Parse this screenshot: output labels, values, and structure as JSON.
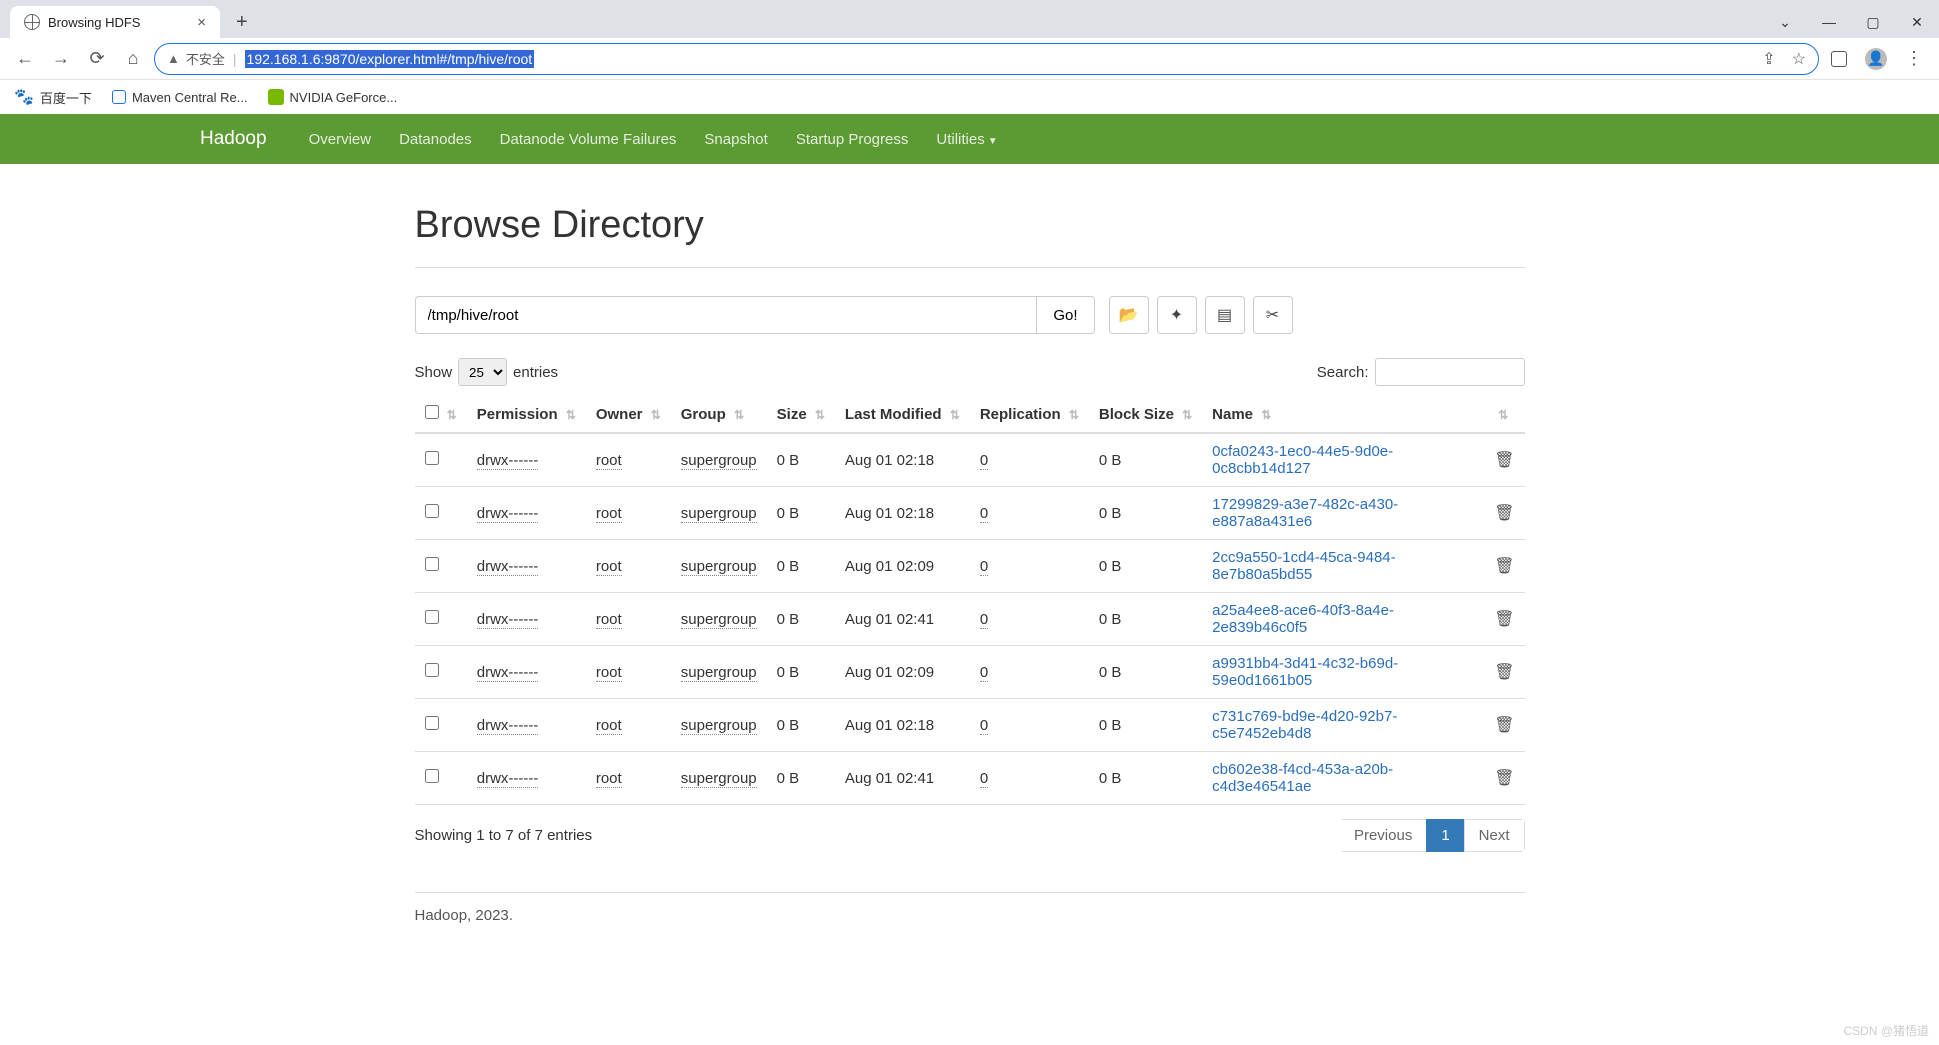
{
  "browser": {
    "tab_title": "Browsing HDFS",
    "insecure_label": "不安全",
    "url_prefix": "",
    "url_highlighted": "192.168.1.6:9870/explorer.html#/tmp/hive/root",
    "bookmarks": [
      {
        "label": "百度一下"
      },
      {
        "label": "Maven Central Re..."
      },
      {
        "label": "NVIDIA GeForce..."
      }
    ]
  },
  "nav": {
    "brand": "Hadoop",
    "items": [
      "Overview",
      "Datanodes",
      "Datanode Volume Failures",
      "Snapshot",
      "Startup Progress",
      "Utilities"
    ]
  },
  "page": {
    "title": "Browse Directory",
    "path_value": "/tmp/hive/root",
    "go_label": "Go!",
    "show_label_pre": "Show",
    "show_label_post": "entries",
    "show_value": "25",
    "search_label": "Search:",
    "search_value": "",
    "columns": [
      "",
      "Permission",
      "Owner",
      "Group",
      "Size",
      "Last Modified",
      "Replication",
      "Block Size",
      "Name",
      ""
    ],
    "rows": [
      {
        "perm": "drwx------",
        "owner": "root",
        "group": "supergroup",
        "size": "0 B",
        "modified": "Aug 01 02:18",
        "rep": "0",
        "block": "0 B",
        "name": "0cfa0243-1ec0-44e5-9d0e-0c8cbb14d127"
      },
      {
        "perm": "drwx------",
        "owner": "root",
        "group": "supergroup",
        "size": "0 B",
        "modified": "Aug 01 02:18",
        "rep": "0",
        "block": "0 B",
        "name": "17299829-a3e7-482c-a430-e887a8a431e6"
      },
      {
        "perm": "drwx------",
        "owner": "root",
        "group": "supergroup",
        "size": "0 B",
        "modified": "Aug 01 02:09",
        "rep": "0",
        "block": "0 B",
        "name": "2cc9a550-1cd4-45ca-9484-8e7b80a5bd55"
      },
      {
        "perm": "drwx------",
        "owner": "root",
        "group": "supergroup",
        "size": "0 B",
        "modified": "Aug 01 02:41",
        "rep": "0",
        "block": "0 B",
        "name": "a25a4ee8-ace6-40f3-8a4e-2e839b46c0f5"
      },
      {
        "perm": "drwx------",
        "owner": "root",
        "group": "supergroup",
        "size": "0 B",
        "modified": "Aug 01 02:09",
        "rep": "0",
        "block": "0 B",
        "name": "a9931bb4-3d41-4c32-b69d-59e0d1661b05"
      },
      {
        "perm": "drwx------",
        "owner": "root",
        "group": "supergroup",
        "size": "0 B",
        "modified": "Aug 01 02:18",
        "rep": "0",
        "block": "0 B",
        "name": "c731c769-bd9e-4d20-92b7-c5e7452eb4d8"
      },
      {
        "perm": "drwx------",
        "owner": "root",
        "group": "supergroup",
        "size": "0 B",
        "modified": "Aug 01 02:41",
        "rep": "0",
        "block": "0 B",
        "name": "cb602e38-f4cd-453a-a20b-c4d3e46541ae"
      }
    ],
    "info_text": "Showing 1 to 7 of 7 entries",
    "prev_label": "Previous",
    "page_num": "1",
    "next_label": "Next",
    "footer": "Hadoop, 2023."
  },
  "watermark": "CSDN @猪悟道"
}
